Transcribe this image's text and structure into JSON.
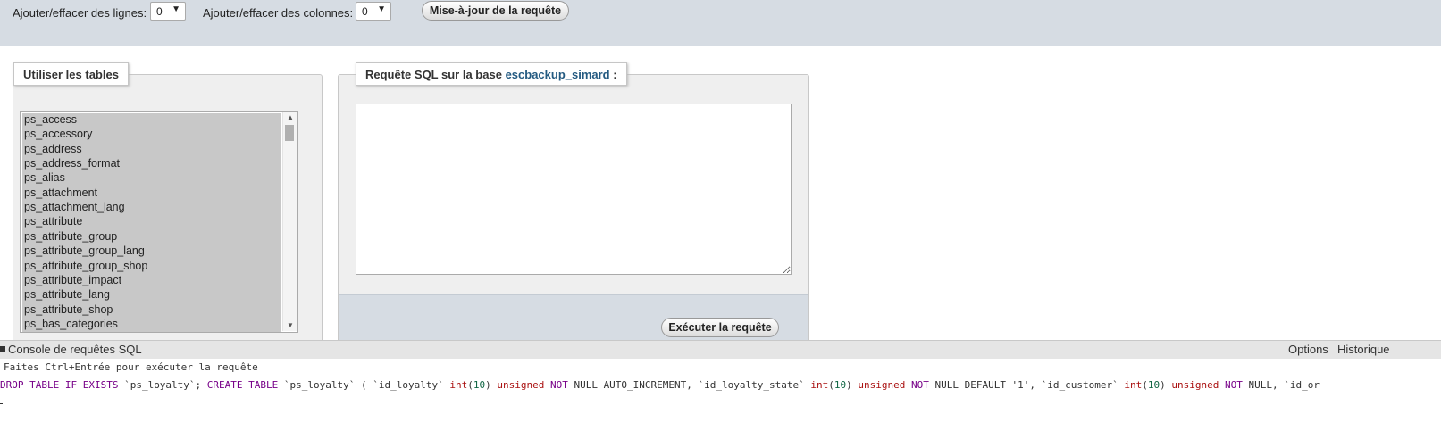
{
  "toolbar": {
    "rows_label": "Ajouter/effacer des lignes:",
    "rows_value": "0",
    "cols_label": "Ajouter/effacer des colonnes:",
    "cols_value": "0",
    "update_button": "Mise-à-jour de la requête"
  },
  "tables_panel": {
    "legend": "Utiliser les tables",
    "items": [
      "ps_access",
      "ps_accessory",
      "ps_address",
      "ps_address_format",
      "ps_alias",
      "ps_attachment",
      "ps_attachment_lang",
      "ps_attribute",
      "ps_attribute_group",
      "ps_attribute_group_lang",
      "ps_attribute_group_shop",
      "ps_attribute_impact",
      "ps_attribute_lang",
      "ps_attribute_shop",
      "ps_bas_categories"
    ]
  },
  "sql_panel": {
    "legend_prefix": "Requête SQL sur la base",
    "database": "escbackup_simard",
    "legend_suffix": ":",
    "query_value": "",
    "execute_button": "Exécuter la requête"
  },
  "console": {
    "title": "Console de requêtes SQL",
    "options_link": "Options",
    "history_link": "Historique",
    "hint": "Faites Ctrl+Entrée pour exécuter la requête",
    "query_tokens": [
      {
        "t": "DROP TABLE IF EXISTS",
        "c": "kw"
      },
      {
        "t": " `ps_loyalty`; ",
        "c": ""
      },
      {
        "t": "CREATE TABLE",
        "c": "kw"
      },
      {
        "t": " `ps_loyalty` ( `id_loyalty` ",
        "c": ""
      },
      {
        "t": "int",
        "c": "ty"
      },
      {
        "t": "(",
        "c": ""
      },
      {
        "t": "10",
        "c": "num"
      },
      {
        "t": ") ",
        "c": ""
      },
      {
        "t": "unsigned",
        "c": "ty"
      },
      {
        "t": " ",
        "c": ""
      },
      {
        "t": "NOT",
        "c": "kw"
      },
      {
        "t": " NULL AUTO_INCREMENT, `id_loyalty_state` ",
        "c": ""
      },
      {
        "t": "int",
        "c": "ty"
      },
      {
        "t": "(",
        "c": ""
      },
      {
        "t": "10",
        "c": "num"
      },
      {
        "t": ") ",
        "c": ""
      },
      {
        "t": "unsigned",
        "c": "ty"
      },
      {
        "t": " ",
        "c": ""
      },
      {
        "t": "NOT",
        "c": "kw"
      },
      {
        "t": " NULL DEFAULT '1', `id_customer` ",
        "c": ""
      },
      {
        "t": "int",
        "c": "ty"
      },
      {
        "t": "(",
        "c": ""
      },
      {
        "t": "10",
        "c": "num"
      },
      {
        "t": ") ",
        "c": ""
      },
      {
        "t": "unsigned",
        "c": "ty"
      },
      {
        "t": " ",
        "c": ""
      },
      {
        "t": "NOT",
        "c": "kw"
      },
      {
        "t": " NULL, `id_or",
        "c": ""
      }
    ]
  }
}
